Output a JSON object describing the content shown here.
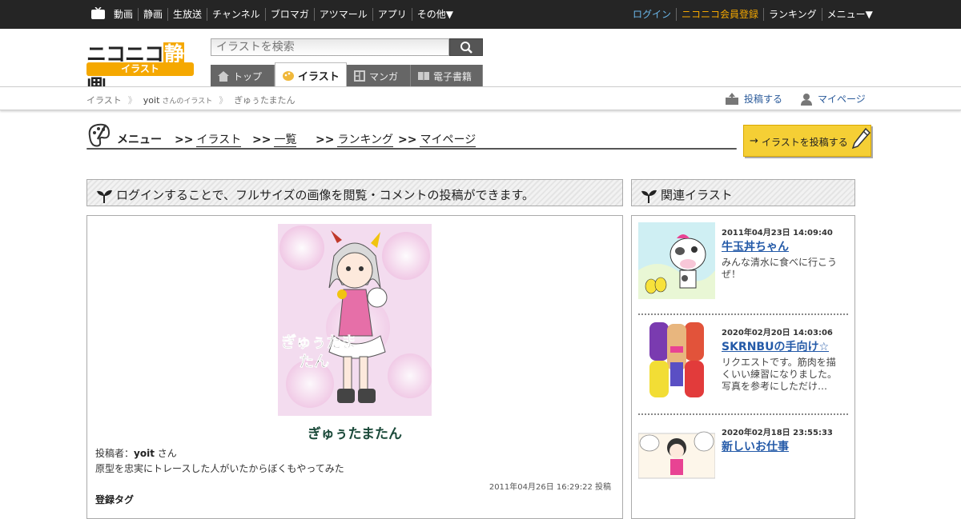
{
  "topbar": {
    "left": [
      "動画",
      "静画",
      "生放送",
      "チャンネル",
      "ブロマガ",
      "アツマール",
      "アプリ",
      "その他▼"
    ],
    "right": [
      "ログイン",
      "ニコニコ会員登録",
      "ランキング",
      "メニュー▼"
    ],
    "colors": {
      "login": "#6bb7ea",
      "register": "#f5a800"
    }
  },
  "logo": {
    "main_a": "ニコニコ",
    "main_b": "静",
    "main_c": "画",
    "sub": "イラスト"
  },
  "search": {
    "placeholder": "イラストを検索"
  },
  "tabs": [
    "トップ",
    "イラスト",
    "マンガ",
    "電子書籍"
  ],
  "breadcrumb": {
    "items": [
      "イラスト",
      "yoit",
      "さんのイラスト",
      "ぎゅぅたまたん"
    ],
    "post": "投稿する",
    "mypage": "マイページ"
  },
  "menu": {
    "label": "メニュー",
    "links": [
      "イラスト",
      "一覧",
      "ランキング",
      "マイページ"
    ],
    "prefix": ">>",
    "post_button": "イラストを投稿する"
  },
  "notice": "ログインすることで、フルサイズの画像を閲覧・コメントの投稿ができます。",
  "related_header": "関連イラスト",
  "illust": {
    "title": "ぎゅぅたまたん",
    "art_text": "ぎゅぅたま\nたん",
    "poster_label": "投稿者：",
    "poster_name": "yoit",
    "poster_suffix": "さん",
    "description": "原型を忠実にトレースした人がいたからぼくもやってみた",
    "date": "2011年04月26日 16:29:22 投稿",
    "tags_heading": "登録タグ"
  },
  "related": [
    {
      "date": "2011年04月23日 14:09:40",
      "title": "牛玉丼ちゃん",
      "desc": "みんな清水に食べに行こうぜ！"
    },
    {
      "date": "2020年02月20日 14:03:06",
      "title": "SKRNBUの手向け☆",
      "desc": "リクエストです。筋肉を描くいい練習になりました。写真を参考にしただけ…"
    },
    {
      "date": "2020年02月18日 23:55:33",
      "title": "新しいお仕事",
      "desc": ""
    }
  ]
}
